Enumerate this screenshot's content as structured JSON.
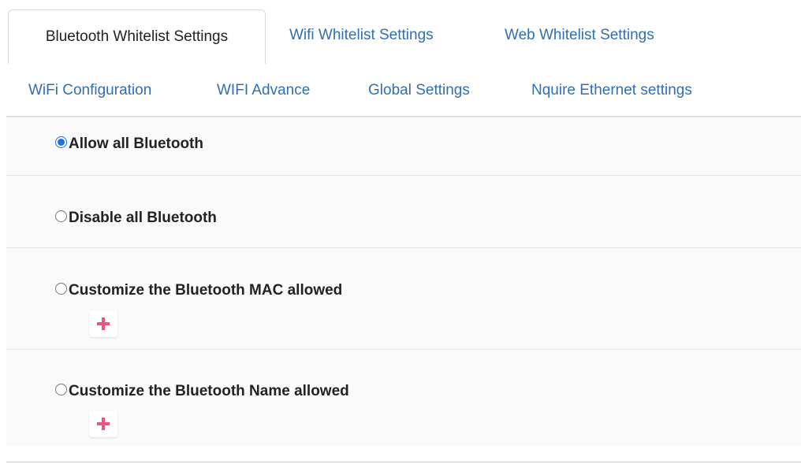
{
  "tabs_row1": [
    {
      "label": "Bluetooth Whitelist Settings",
      "active": true
    },
    {
      "label": "Wifi Whitelist Settings",
      "active": false
    },
    {
      "label": "Web Whitelist Settings",
      "active": false
    }
  ],
  "tabs_row2": [
    {
      "label": "WiFi Configuration",
      "active": false
    },
    {
      "label": "WIFI Advance",
      "active": false
    },
    {
      "label": "Global Settings",
      "active": false
    },
    {
      "label": "Nquire Ethernet settings",
      "active": false
    }
  ],
  "options": [
    {
      "label": "Allow all Bluetooth",
      "checked": true
    },
    {
      "label": "Disable all Bluetooth",
      "checked": false
    },
    {
      "label": "Customize the Bluetooth MAC allowed",
      "checked": false,
      "add_icon": "plus-icon"
    },
    {
      "label": "Customize the Bluetooth Name allowed",
      "checked": false,
      "add_icon": "plus-icon"
    }
  ],
  "colors": {
    "tab_link": "#2f6fb2",
    "radio_checked": "#1a73e8",
    "add_icon": "#e8567f",
    "panel_bg": "#fafafa"
  }
}
